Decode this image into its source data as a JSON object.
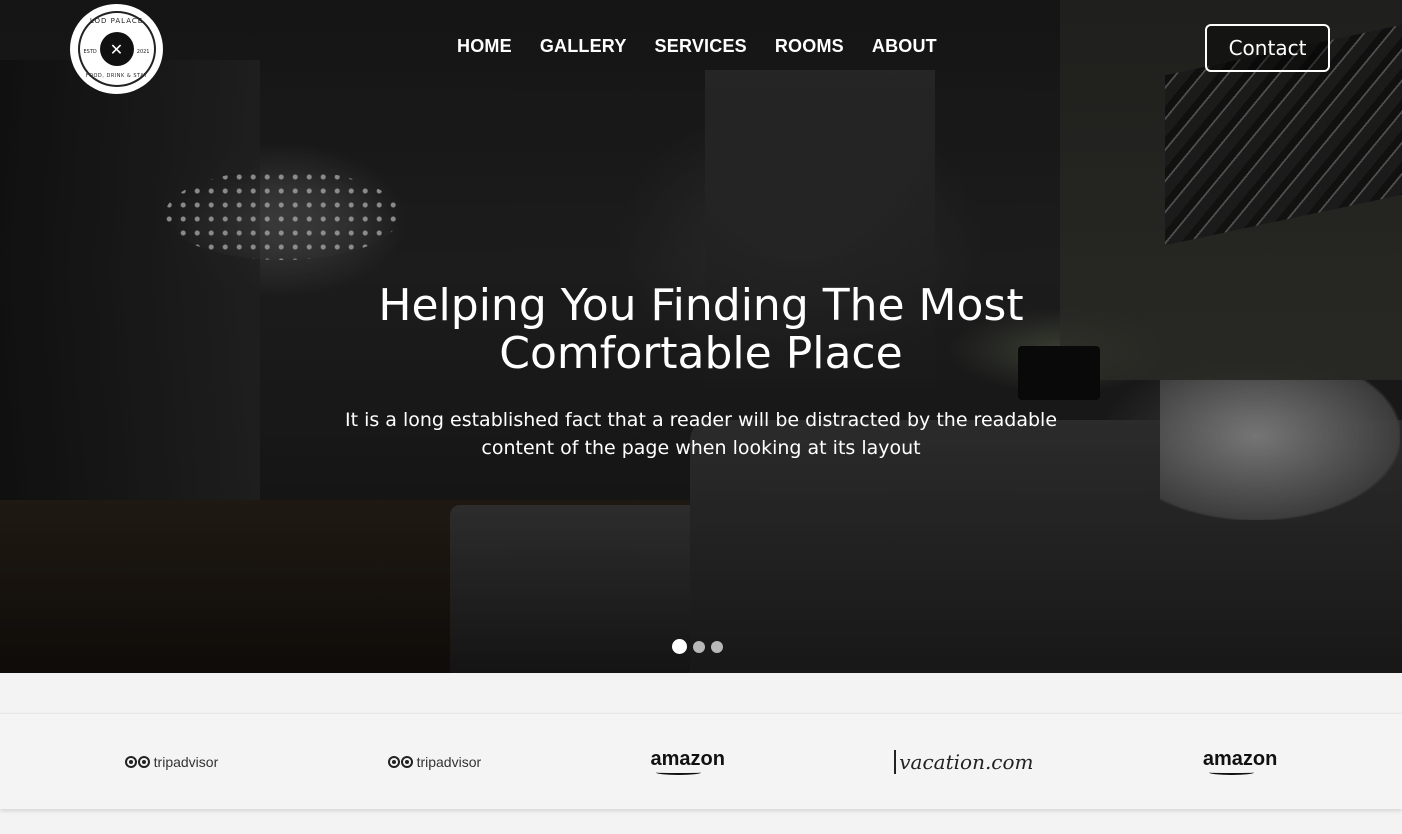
{
  "logo": {
    "top_text": "LOD PALACE",
    "bottom_text": "FOOD, DRINK & STAY",
    "esto": "ESTD",
    "year": "2021",
    "icon": "fork-knife-flame-icon"
  },
  "nav": {
    "items": [
      "HOME",
      "GALLERY",
      "SERVICES",
      "ROOMS",
      "ABOUT"
    ]
  },
  "contact_label": "Contact",
  "hero": {
    "title_line1": "Helping You Finding The Most",
    "title_line2": "Comfortable Place",
    "subtitle_line1": "It is a long established fact that a reader will be distracted by the readable",
    "subtitle_line2": "content of the page when looking at its layout",
    "slides_count": 3,
    "active_slide": 1
  },
  "partners": [
    {
      "name": "tripadvisor",
      "icon": "tripadvisor-owl-icon"
    },
    {
      "name": "tripadvisor",
      "icon": "tripadvisor-owl-icon"
    },
    {
      "name": "amazon",
      "icon": "amazon-smile-icon"
    },
    {
      "name": "vacation.com",
      "icon": "vacation-logo-icon"
    },
    {
      "name": "amazon",
      "icon": "amazon-smile-icon"
    }
  ],
  "colors": {
    "text_on_hero": "#ffffff",
    "strip_bg": "#f4f4f4",
    "dot_inactive": "#b8b8b8"
  }
}
